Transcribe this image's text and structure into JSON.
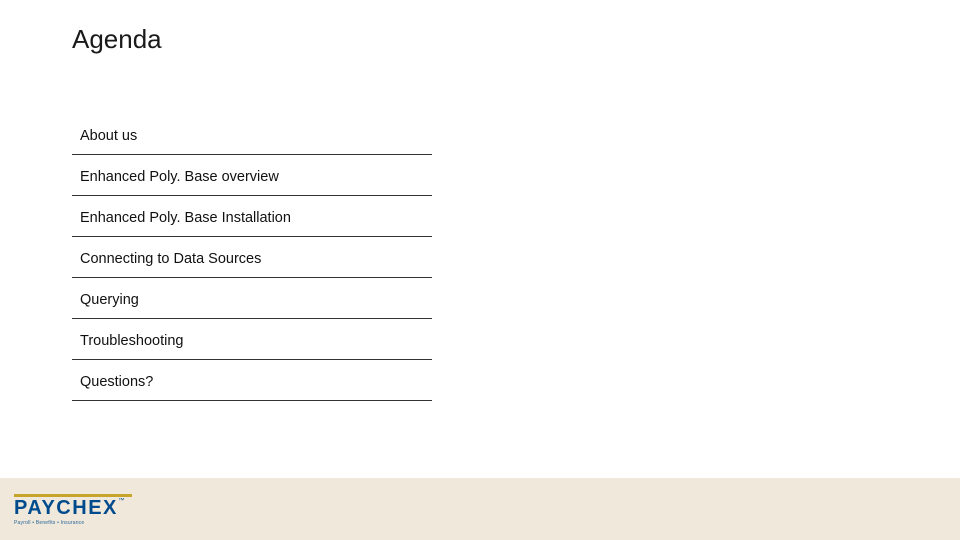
{
  "title": "Agenda",
  "agenda": {
    "items": [
      {
        "label": "About us"
      },
      {
        "label": "Enhanced Poly. Base overview"
      },
      {
        "label": "Enhanced Poly. Base Installation"
      },
      {
        "label": "Connecting to Data Sources"
      },
      {
        "label": "Querying"
      },
      {
        "label": "Troubleshooting"
      },
      {
        "label": "Questions?"
      }
    ]
  },
  "logo": {
    "name": "PAYCHEX",
    "tagline": "Payroll • Benefits • Insurance"
  }
}
